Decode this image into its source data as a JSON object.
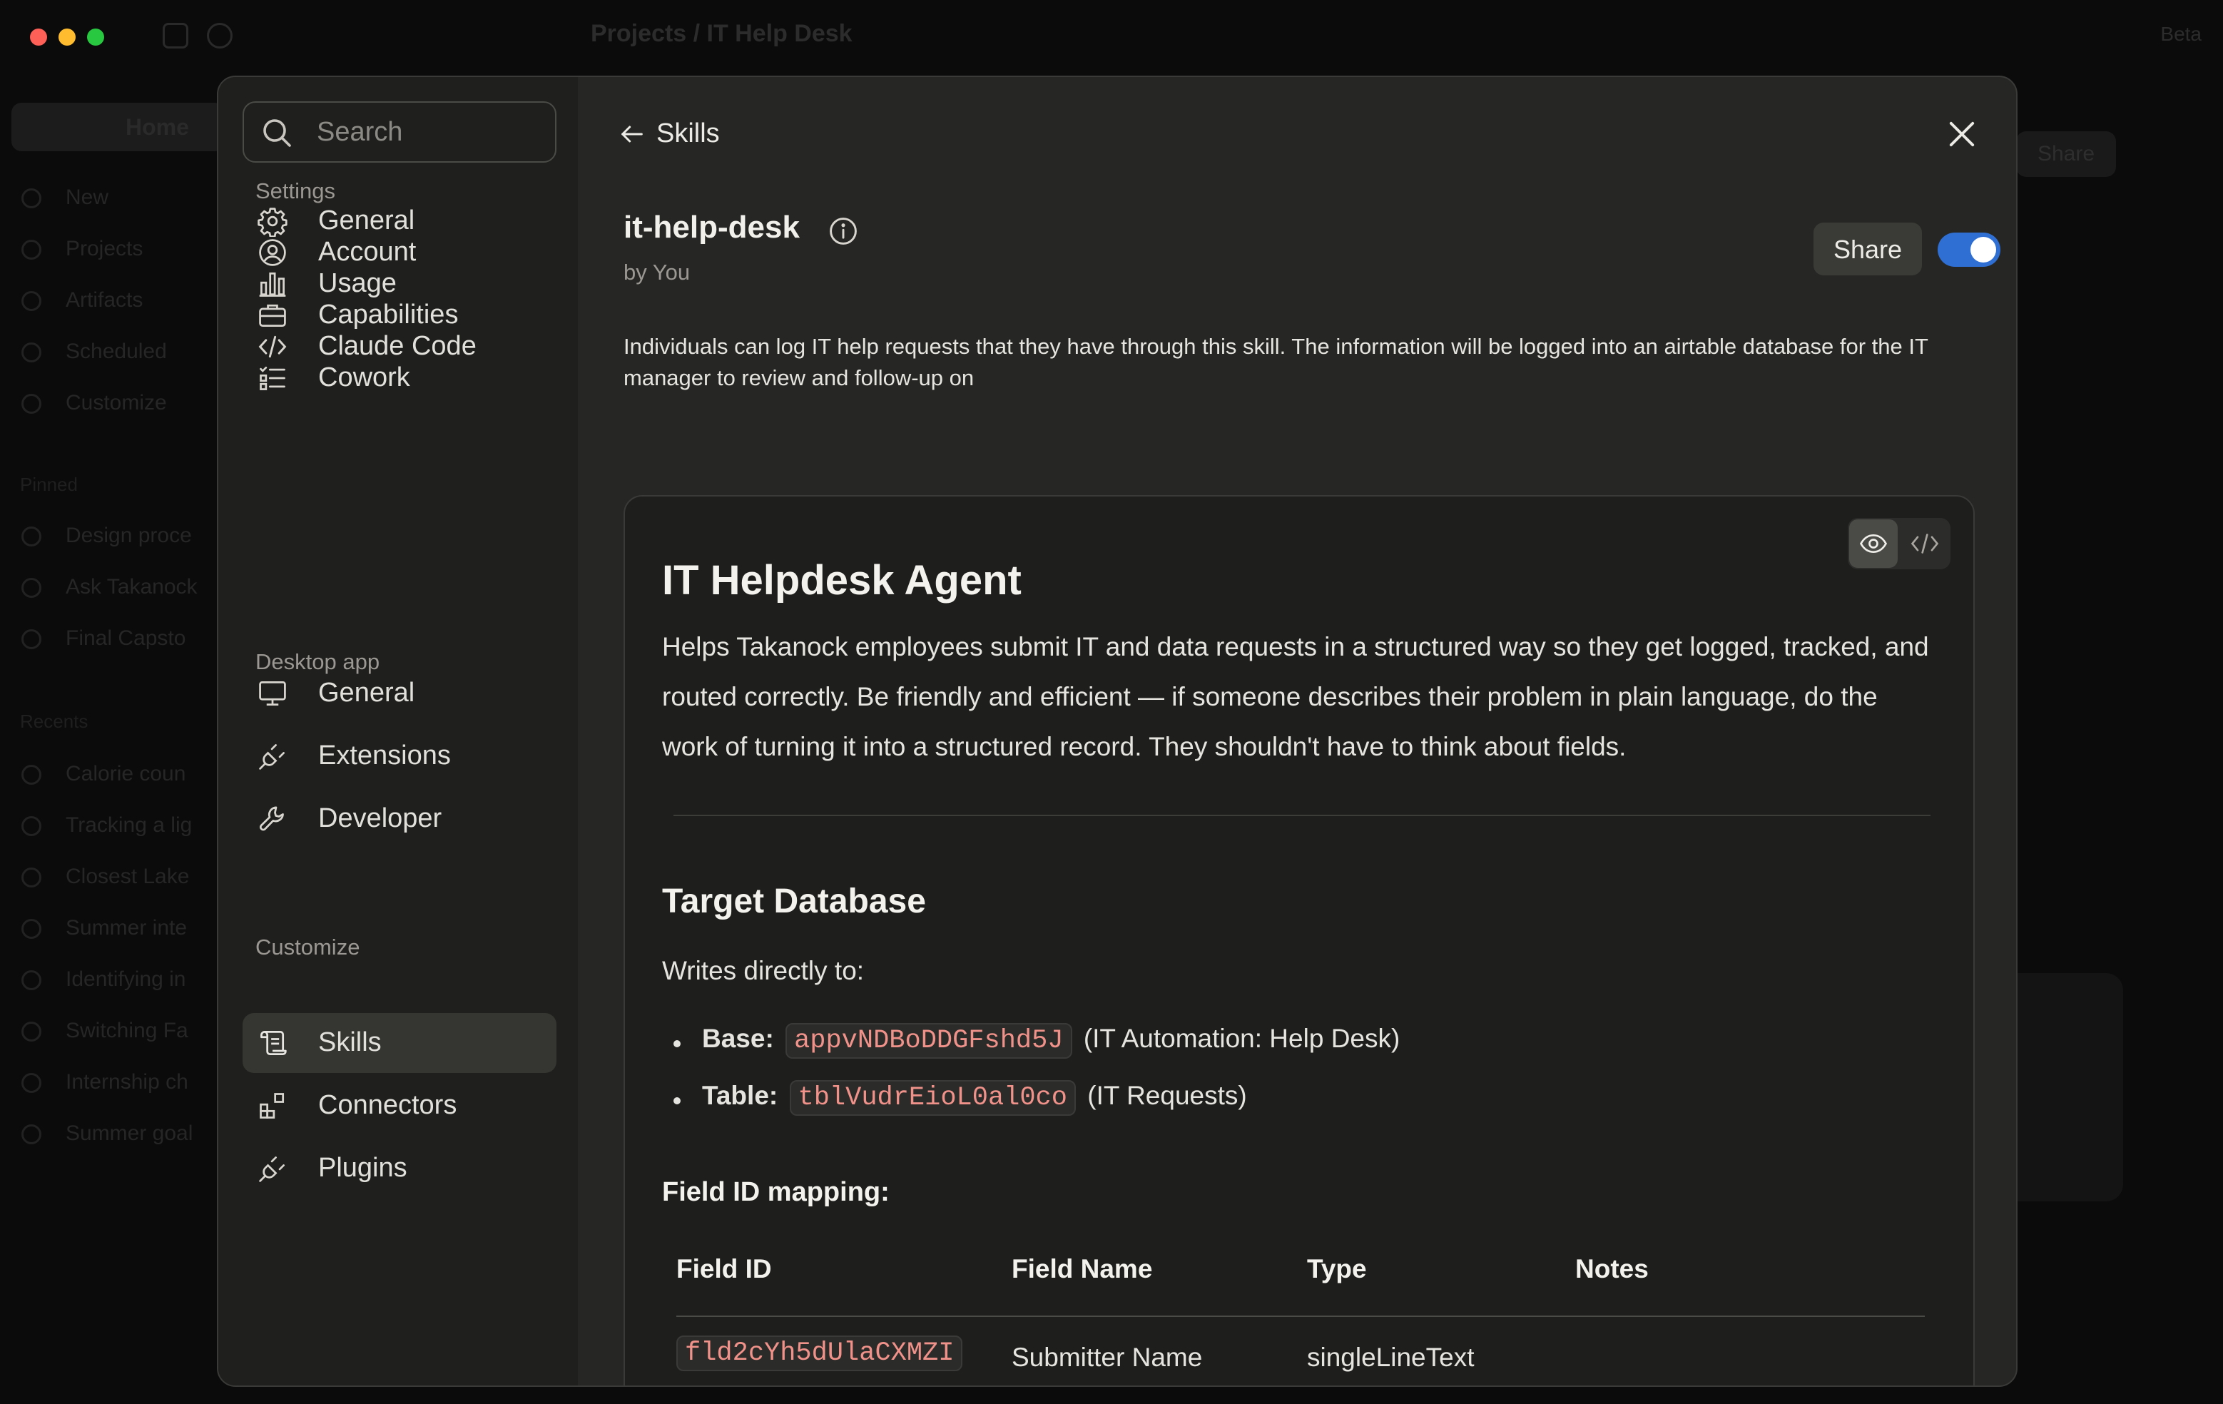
{
  "background": {
    "breadcrumb": "Projects  /  IT Help Desk",
    "beta": "Beta",
    "home": "Home",
    "share": "Share",
    "nav_rows": [
      "New",
      "Projects",
      "Artifacts",
      "Scheduled",
      "Customize"
    ],
    "pinned_label": "Pinned",
    "pinned_rows": [
      "Design proce",
      "Ask Takanock",
      "Final Capsto"
    ],
    "recents_label": "Recents",
    "recent_rows": [
      "Calorie coun",
      "Tracking a lig",
      "Closest Lake",
      "Summer inte",
      "Identifying in",
      "Switching Fa",
      "Internship ch",
      "Summer goal"
    ]
  },
  "sidebar": {
    "search_placeholder": "Search",
    "sections": [
      {
        "label": "Settings",
        "items": [
          {
            "label": "General",
            "icon": "gear-icon"
          },
          {
            "label": "Account",
            "icon": "user-circle-icon"
          },
          {
            "label": "Usage",
            "icon": "bar-chart-icon"
          },
          {
            "label": "Capabilities",
            "icon": "briefcase-icon"
          },
          {
            "label": "Claude Code",
            "icon": "code-icon"
          },
          {
            "label": "Cowork",
            "icon": "checklist-icon"
          }
        ]
      },
      {
        "label": "Desktop app",
        "items": [
          {
            "label": "General",
            "icon": "monitor-icon"
          },
          {
            "label": "Extensions",
            "icon": "plug-icon"
          },
          {
            "label": "Developer",
            "icon": "wrench-icon"
          }
        ]
      },
      {
        "label": "Customize",
        "items": [
          {
            "label": "Skills",
            "icon": "scroll-icon",
            "active": true
          },
          {
            "label": "Connectors",
            "icon": "blocks-icon"
          },
          {
            "label": "Plugins",
            "icon": "plug-icon"
          }
        ]
      }
    ]
  },
  "header": {
    "back_label": "Skills",
    "skill_name": "it-help-desk",
    "author": "by You",
    "share_label": "Share",
    "enabled": true
  },
  "description": "Individuals can log IT help requests that they have through this skill. The information will be logged into an airtable database for the IT manager to review and follow-up on",
  "preview": {
    "h1": "IT Helpdesk Agent",
    "intro": "Helps Takanock employees submit IT and data requests in a structured way so they get logged, tracked, and routed correctly. Be friendly and efficient — if someone describes their problem in plain language, do the work of turning it into a structured record. They shouldn't have to think about fields.",
    "h2": "Target Database",
    "writes": "Writes directly to:",
    "bullets": [
      {
        "label": "Base:",
        "code": "appvNDBoDDGFshd5J",
        "suffix": "(IT Automation: Help Desk)"
      },
      {
        "label": "Table:",
        "code": "tblVudrEioL0al0co",
        "suffix": "(IT Requests)"
      }
    ],
    "h3": "Field ID mapping:",
    "table": {
      "headers": [
        "Field ID",
        "Field Name",
        "Type",
        "Notes"
      ],
      "rows": [
        {
          "field_id": "fld2cYh5dUlaCXMZI",
          "field_name": "Submitter Name",
          "type": "singleLineText",
          "notes": ""
        }
      ]
    }
  }
}
